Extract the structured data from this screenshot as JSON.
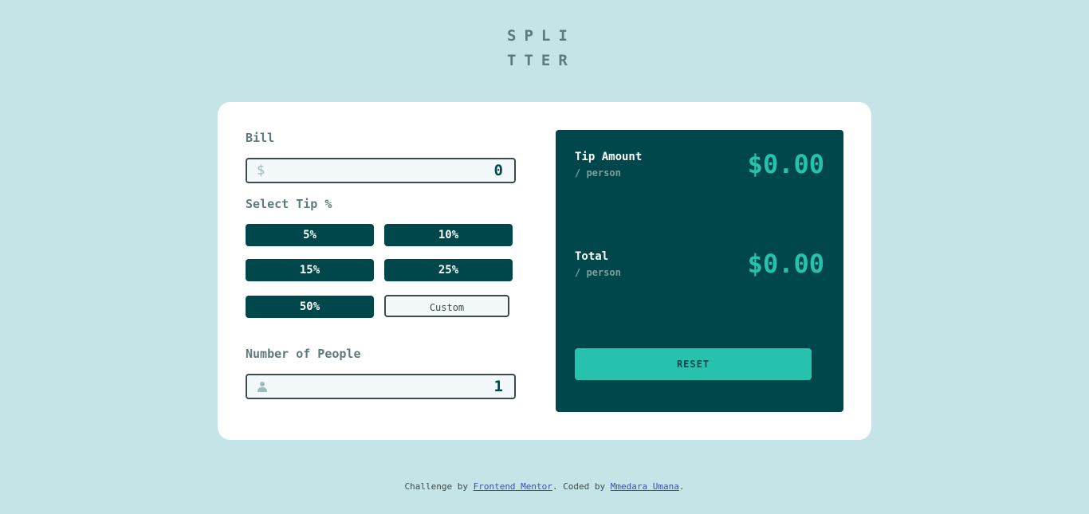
{
  "logo": {
    "line1": "SPLI",
    "line2": "TTER"
  },
  "bill": {
    "label": "Bill",
    "currency_symbol": "$",
    "value": "0"
  },
  "tip": {
    "label": "Select Tip %",
    "options": [
      "5%",
      "10%",
      "15%",
      "25%",
      "50%"
    ],
    "custom_placeholder": "Custom"
  },
  "people": {
    "label": "Number of People",
    "value": "1",
    "icon": "person-icon"
  },
  "results": {
    "tip_amount_label": "Tip Amount",
    "tip_amount_sub": "/ person",
    "tip_amount_value": "$0.00",
    "total_label": "Total",
    "total_sub": "/ person",
    "total_value": "$0.00",
    "reset_label": "RESET"
  },
  "footer": {
    "prefix": "Challenge by ",
    "link1": "Frontend Mentor",
    "middle": ". Coded by ",
    "link2": "Mmedara Umana",
    "suffix": "."
  },
  "colors": {
    "background": "#c5e4e7",
    "dark_cyan": "#00474b",
    "strong_cyan": "#26c2ad",
    "label_gray": "#5e7a7d"
  }
}
